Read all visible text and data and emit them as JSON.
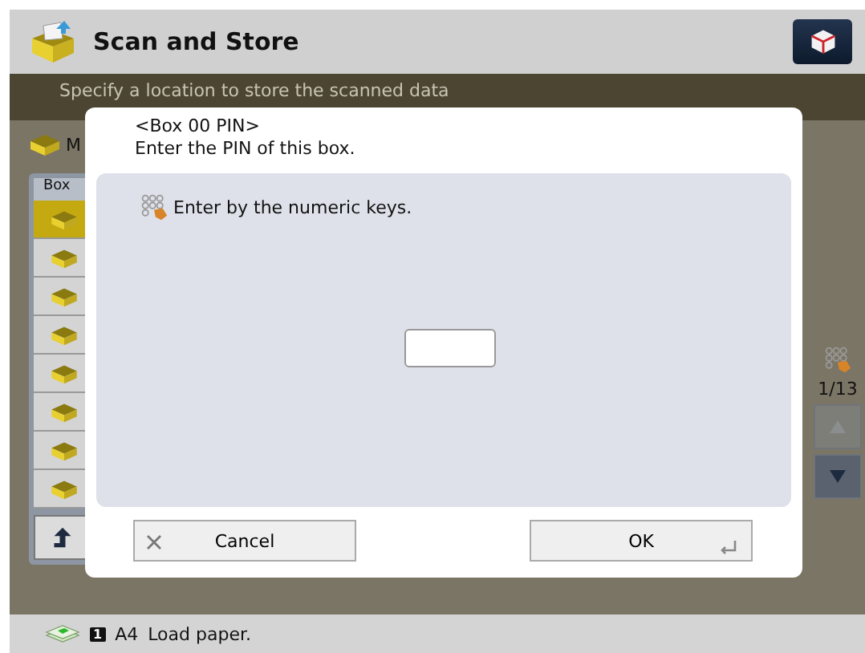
{
  "header": {
    "title": "Scan and Store"
  },
  "instruction": "Specify a location to store the scanned data",
  "location_label": "M",
  "box_list": {
    "column_1": "Box",
    "rows": [
      {
        "selected": true
      },
      {
        "selected": false
      },
      {
        "selected": false
      },
      {
        "selected": false
      },
      {
        "selected": false
      },
      {
        "selected": false
      },
      {
        "selected": false
      },
      {
        "selected": false
      }
    ]
  },
  "pager": {
    "page": "1/13",
    "up_disabled": true,
    "down_disabled": false
  },
  "dialog": {
    "title": "<Box 00 PIN>",
    "message": "Enter the PIN of this box.",
    "hint": "Enter by the numeric keys.",
    "buttons": [
      {
        "label": "Cancel",
        "kind": "cancel"
      },
      {
        "label": "OK",
        "kind": "ok"
      }
    ]
  },
  "status_bar": {
    "tray": "1",
    "paper_size": "A4",
    "message": "Load paper."
  }
}
